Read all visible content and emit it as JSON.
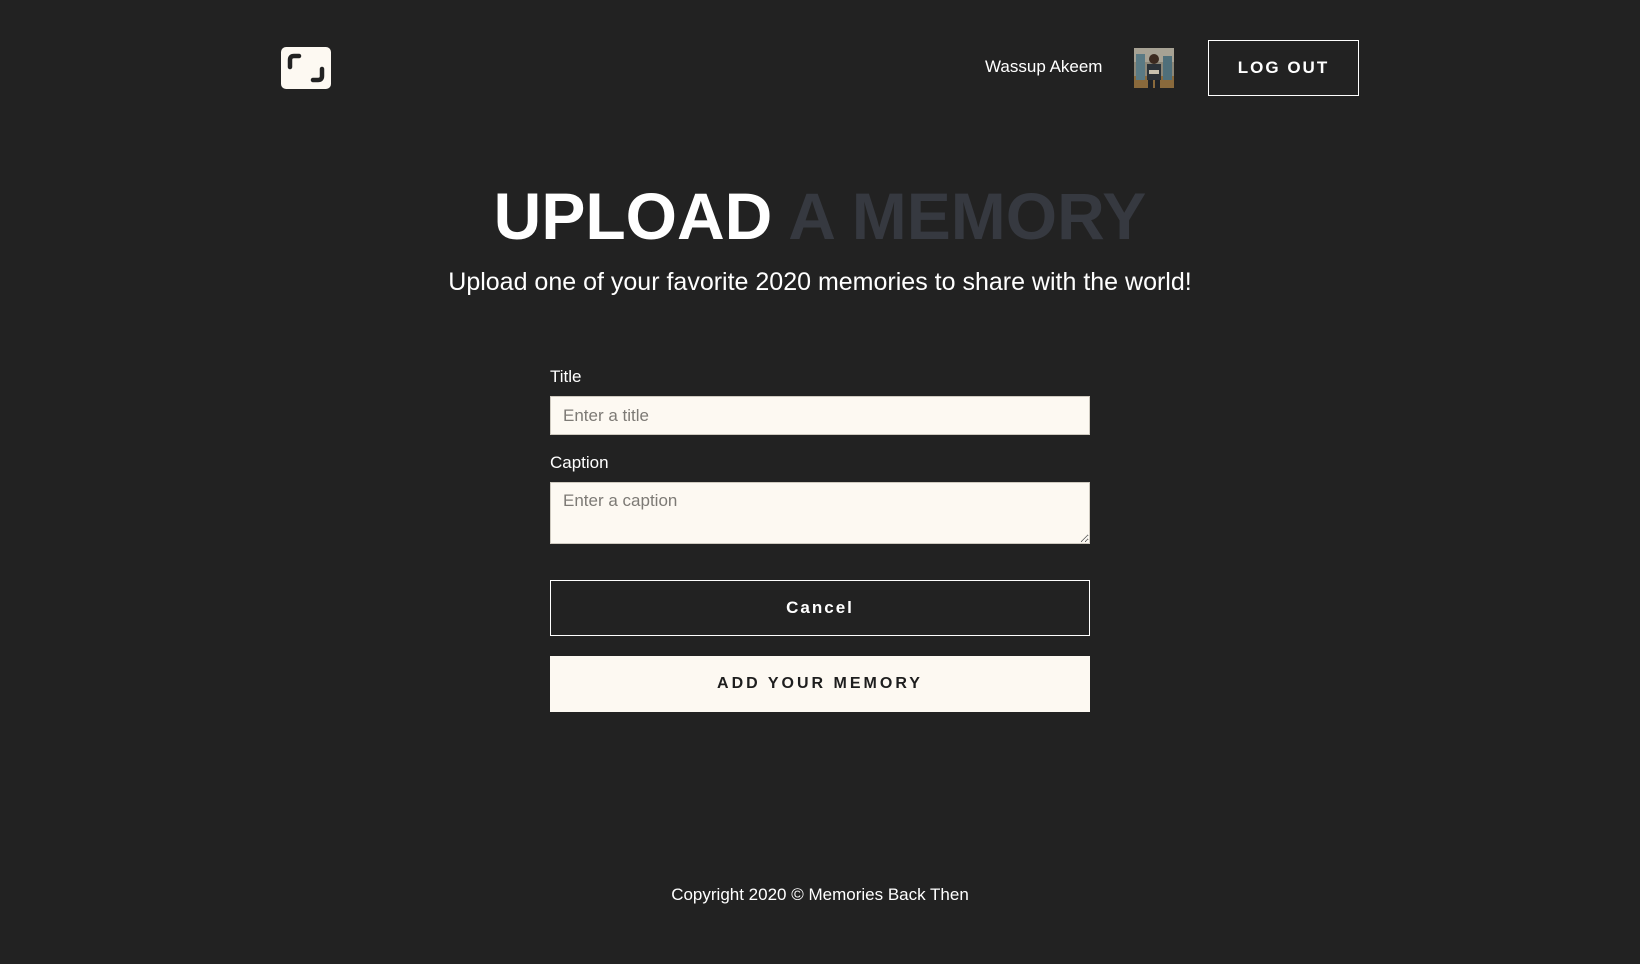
{
  "header": {
    "logo_icon": "bracket-frame-icon",
    "greeting": "Wassup Akeem",
    "avatar_icon": "user-avatar",
    "logout_label": "LOG OUT"
  },
  "hero": {
    "title_part1": "UPLOAD",
    "title_part2": "A MEMORY",
    "subtitle": "Upload one of your favorite 2020 memories to share with the world!"
  },
  "form": {
    "title_label": "Title",
    "title_placeholder": "Enter a title",
    "title_value": "",
    "caption_label": "Caption",
    "caption_placeholder": "Enter a caption",
    "caption_value": "",
    "cancel_label": "Cancel",
    "submit_label": "ADD YOUR MEMORY"
  },
  "footer": {
    "copyright": "Copyright 2020 © Memories Back Then"
  },
  "colors": {
    "background": "#222222",
    "cream": "#fdf9f2",
    "title_dim": "#363940",
    "text": "#ffffff"
  }
}
